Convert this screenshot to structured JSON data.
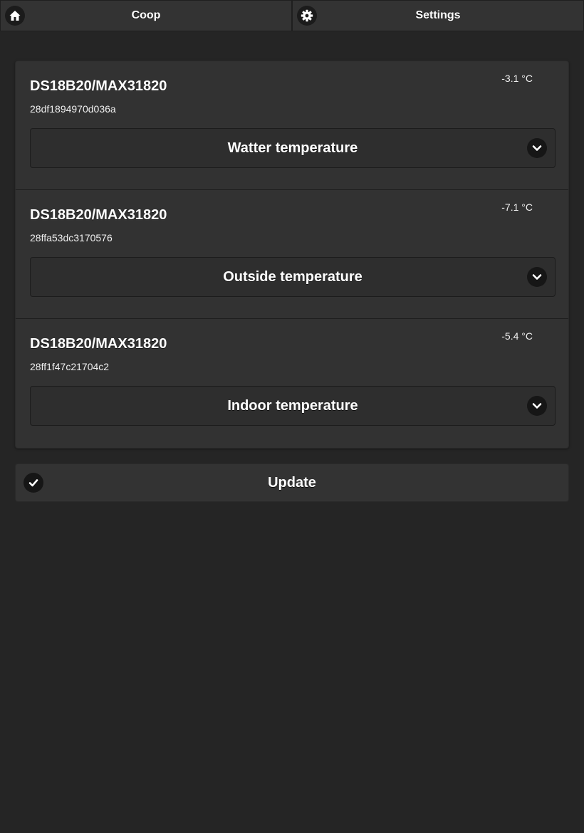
{
  "navbar": {
    "home_label": "Coop",
    "home_icon": "home-icon",
    "settings_label": "Settings",
    "settings_icon": "gear-icon"
  },
  "sensors": [
    {
      "model": "DS18B20/MAX31820",
      "id": "28df1894970d036a",
      "temperature": "-3.1 °C",
      "name": "Watter temperature",
      "dropdown_icon": "chevron-down-icon"
    },
    {
      "model": "DS18B20/MAX31820",
      "id": "28ffa53dc3170576",
      "temperature": "-7.1 °C",
      "name": "Outside temperature",
      "dropdown_icon": "chevron-down-icon"
    },
    {
      "model": "DS18B20/MAX31820",
      "id": "28ff1f47c21704c2",
      "temperature": "-5.4 °C",
      "name": "Indoor temperature",
      "dropdown_icon": "chevron-down-icon"
    }
  ],
  "update": {
    "label": "Update",
    "icon": "check-icon"
  },
  "colors": {
    "background": "#252525",
    "panel": "#323232",
    "text": "#ffffff"
  }
}
